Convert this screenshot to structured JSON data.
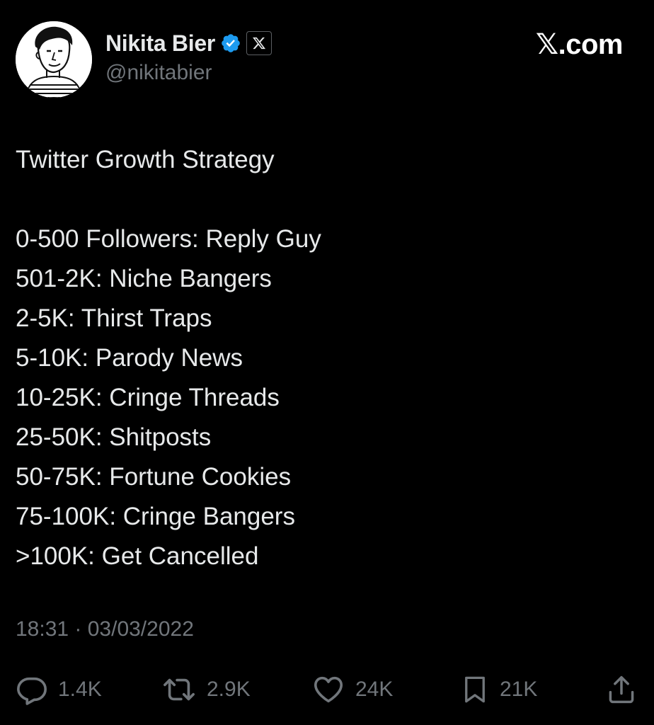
{
  "author": {
    "display_name": "Nikita Bier",
    "handle": "@nikitabier",
    "avatar_icon": "cartoon-portrait-avatar",
    "verified_icon": "verified-badge-icon",
    "affiliate_icon": "x-logo-icon"
  },
  "brand": {
    "label": "𝕏.com"
  },
  "tweet": {
    "title": "Twitter Growth Strategy",
    "lines": [
      "0-500 Followers: Reply Guy",
      "501-2K: Niche Bangers",
      "2-5K: Thirst Traps",
      "5-10K: Parody News",
      "10-25K: Cringe Threads",
      "25-50K: Shitposts",
      "50-75K: Fortune Cookies",
      "75-100K: Cringe Bangers",
      ">100K: Get Cancelled"
    ],
    "timestamp": "18:31 · 03/03/2022"
  },
  "actions": {
    "replies": {
      "icon": "reply-bubble-icon",
      "count": "1.4K"
    },
    "retweets": {
      "icon": "retweet-icon",
      "count": "2.9K"
    },
    "likes": {
      "icon": "heart-icon",
      "count": "24K"
    },
    "bookmarks": {
      "icon": "bookmark-icon",
      "count": "21K"
    },
    "share": {
      "icon": "share-icon"
    }
  },
  "colors": {
    "background": "#000000",
    "text": "#e7e9ea",
    "secondary_text": "#71767b",
    "verified_blue": "#1d9bf0"
  }
}
